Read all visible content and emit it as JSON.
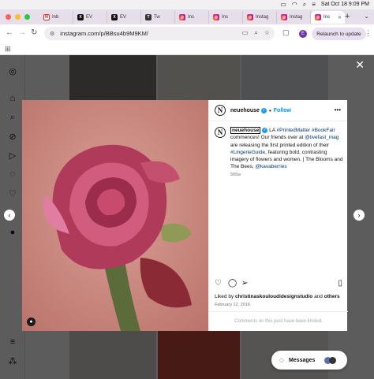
{
  "menubar": {
    "datetime": "Sat Oct 18  9:09 PM"
  },
  "tabs": [
    {
      "label": "Inb",
      "favicon": "gmail-icon"
    },
    {
      "label": "EV",
      "favicon": "x-icon"
    },
    {
      "label": "EV",
      "favicon": "x-icon"
    },
    {
      "label": "Tw",
      "favicon": "twitter-icon"
    },
    {
      "label": "Ins",
      "favicon": "instagram-icon"
    },
    {
      "label": "Ins",
      "favicon": "instagram-icon"
    },
    {
      "label": "Instag",
      "favicon": "instagram-icon"
    },
    {
      "label": "Instag",
      "favicon": "instagram-icon"
    },
    {
      "label": "Ins",
      "favicon": "instagram-icon",
      "active": true
    }
  ],
  "addressbar": {
    "url": "instagram.com/p/BBsu4b9M9KM/",
    "profile_initial": "E",
    "relaunch_label": "Relaunch to update"
  },
  "post": {
    "username": "neuehouse",
    "follow_label": "Follow",
    "logo_letter": "N",
    "caption_handle": "neuehouse",
    "caption_segments": [
      {
        "text": " LA ",
        "link": false
      },
      {
        "text": "#PrintedMatter",
        "link": true
      },
      {
        "text": " ",
        "link": false
      },
      {
        "text": "#BookFair",
        "link": true
      },
      {
        "text": " commences! Our friends over at ",
        "link": false
      },
      {
        "text": "@livefast_mag",
        "link": true
      },
      {
        "text": " are releasing the first printed edition of their ",
        "link": false
      },
      {
        "text": "#LingerieGuide",
        "link": true
      },
      {
        "text": ", featuring bold, contrasting imagery of flowers and women. | The Blooms and The Bees, ",
        "link": false
      },
      {
        "text": "@kavaberries",
        "link": true
      }
    ],
    "caption_age": "505w",
    "liked_by_prefix": "Liked by ",
    "liked_by_user": "christinaskouloudidesignstudio",
    "liked_by_and": " and ",
    "liked_by_others": "others",
    "date": "February 12, 2016",
    "comments_limited": "Comments on this post have been limited."
  },
  "messages": {
    "label": "Messages"
  },
  "colors": {
    "link": "#00376b",
    "follow": "#0095f6",
    "accent_purple": "#6b35a8"
  }
}
